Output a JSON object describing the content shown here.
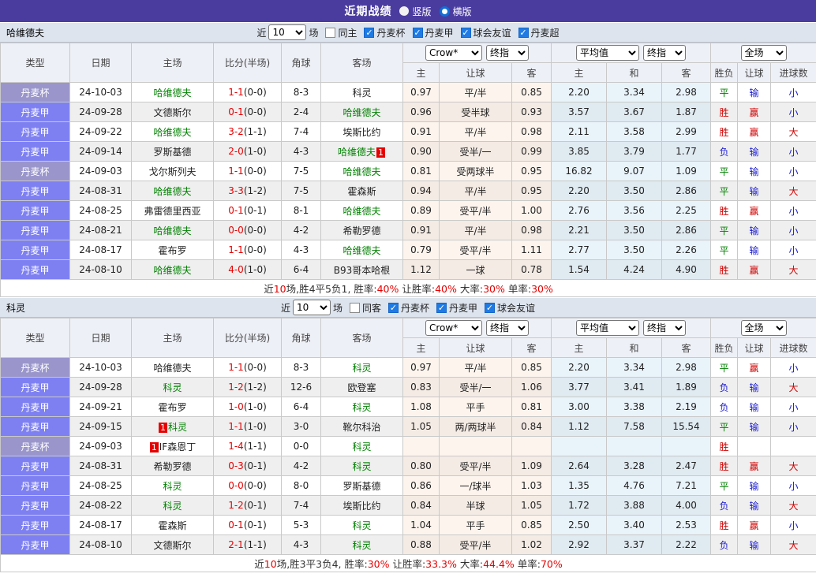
{
  "title_bar": {
    "title": "近期战绩",
    "radios": [
      {
        "label": "竖版",
        "selected": false
      },
      {
        "label": "横版",
        "selected": true
      }
    ]
  },
  "table_columns": {
    "type": "类型",
    "date": "日期",
    "home": "主场",
    "score": "比分(半场)",
    "corner": "角球",
    "away": "客场",
    "odds_home": "主",
    "odds_handicap": "让球",
    "odds_away": "客",
    "avg_home": "主",
    "avg_draw": "和",
    "avg_away": "客",
    "result": "胜负",
    "handicap_result": "让球",
    "goals": "进球数"
  },
  "sections": [
    {
      "team": "哈维德夫",
      "filter": {
        "near_label": "近",
        "count": "10",
        "games_label": "场",
        "same_label": "同主",
        "same_checked": false,
        "leagues": [
          {
            "label": "丹麦杯",
            "checked": true
          },
          {
            "label": "丹麦甲",
            "checked": true
          },
          {
            "label": "球会友谊",
            "checked": true
          },
          {
            "label": "丹麦超",
            "checked": true
          }
        ]
      },
      "selects": {
        "bookmaker": "Crow*",
        "odds_stage": "终指",
        "average": "平均值",
        "avg_stage": "终指",
        "scope": "全场"
      },
      "rows": [
        {
          "league": "丹麦杯",
          "cup": true,
          "date": "24-10-03",
          "home": {
            "name": "哈维德夫",
            "green": true
          },
          "score": "1-1",
          "half": "(0-0)",
          "corner": "8-3",
          "away": {
            "name": "科灵",
            "green": false
          },
          "o1": "0.97",
          "hc": "平/半",
          "o2": "0.85",
          "a1": "2.20",
          "a2": "3.34",
          "a3": "2.98",
          "res": "平",
          "hres": "输",
          "goals": "小"
        },
        {
          "league": "丹麦甲",
          "cup": false,
          "date": "24-09-28",
          "home": {
            "name": "文德斯尔",
            "green": false
          },
          "score": "0-1",
          "half": "(0-0)",
          "corner": "2-4",
          "away": {
            "name": "哈维德夫",
            "green": true
          },
          "o1": "0.96",
          "hc": "受半球",
          "o2": "0.93",
          "a1": "3.57",
          "a2": "3.67",
          "a3": "1.87",
          "res": "胜",
          "hres": "赢",
          "goals": "小"
        },
        {
          "league": "丹麦甲",
          "cup": false,
          "date": "24-09-22",
          "home": {
            "name": "哈维德夫",
            "green": true
          },
          "score": "3-2",
          "half": "(1-1)",
          "corner": "7-4",
          "away": {
            "name": "埃斯比约",
            "green": false
          },
          "o1": "0.91",
          "hc": "平/半",
          "o2": "0.98",
          "a1": "2.11",
          "a2": "3.58",
          "a3": "2.99",
          "res": "胜",
          "hres": "赢",
          "goals": "大"
        },
        {
          "league": "丹麦甲",
          "cup": false,
          "date": "24-09-14",
          "home": {
            "name": "罗斯基德",
            "green": false
          },
          "score": "2-0",
          "half": "(1-0)",
          "corner": "4-3",
          "away": {
            "name": "哈维德夫",
            "green": true,
            "badge_after": "1"
          },
          "o1": "0.90",
          "hc": "受半/一",
          "o2": "0.99",
          "a1": "3.85",
          "a2": "3.79",
          "a3": "1.77",
          "res": "负",
          "hres": "输",
          "goals": "小"
        },
        {
          "league": "丹麦杯",
          "cup": true,
          "date": "24-09-03",
          "home": {
            "name": "戈尔斯列夫",
            "green": false
          },
          "score": "1-1",
          "half": "(0-0)",
          "corner": "7-5",
          "away": {
            "name": "哈维德夫",
            "green": true
          },
          "o1": "0.81",
          "hc": "受两球半",
          "o2": "0.95",
          "a1": "16.82",
          "a2": "9.07",
          "a3": "1.09",
          "res": "平",
          "hres": "输",
          "goals": "小"
        },
        {
          "league": "丹麦甲",
          "cup": false,
          "date": "24-08-31",
          "home": {
            "name": "哈维德夫",
            "green": true
          },
          "score": "3-3",
          "half": "(1-2)",
          "corner": "7-5",
          "away": {
            "name": "霍森斯",
            "green": false
          },
          "o1": "0.94",
          "hc": "平/半",
          "o2": "0.95",
          "a1": "2.20",
          "a2": "3.50",
          "a3": "2.86",
          "res": "平",
          "hres": "输",
          "goals": "大"
        },
        {
          "league": "丹麦甲",
          "cup": false,
          "date": "24-08-25",
          "home": {
            "name": "弗雷德里西亚",
            "green": false
          },
          "score": "0-1",
          "half": "(0-1)",
          "corner": "8-1",
          "away": {
            "name": "哈维德夫",
            "green": true
          },
          "o1": "0.89",
          "hc": "受平/半",
          "o2": "1.00",
          "a1": "2.76",
          "a2": "3.56",
          "a3": "2.25",
          "res": "胜",
          "hres": "赢",
          "goals": "小"
        },
        {
          "league": "丹麦甲",
          "cup": false,
          "date": "24-08-21",
          "home": {
            "name": "哈维德夫",
            "green": true
          },
          "score": "0-0",
          "half": "(0-0)",
          "corner": "4-2",
          "away": {
            "name": "希勒罗德",
            "green": false
          },
          "o1": "0.91",
          "hc": "平/半",
          "o2": "0.98",
          "a1": "2.21",
          "a2": "3.50",
          "a3": "2.86",
          "res": "平",
          "hres": "输",
          "goals": "小"
        },
        {
          "league": "丹麦甲",
          "cup": false,
          "date": "24-08-17",
          "home": {
            "name": "霍布罗",
            "green": false
          },
          "score": "1-1",
          "half": "(0-0)",
          "corner": "4-3",
          "away": {
            "name": "哈维德夫",
            "green": true
          },
          "o1": "0.79",
          "hc": "受平/半",
          "o2": "1.11",
          "a1": "2.77",
          "a2": "3.50",
          "a3": "2.26",
          "res": "平",
          "hres": "输",
          "goals": "小"
        },
        {
          "league": "丹麦甲",
          "cup": false,
          "date": "24-08-10",
          "home": {
            "name": "哈维德夫",
            "green": true
          },
          "score": "4-0",
          "half": "(1-0)",
          "corner": "6-4",
          "away": {
            "name": "B93哥本哈根",
            "green": false
          },
          "o1": "1.12",
          "hc": "一球",
          "o2": "0.78",
          "a1": "1.54",
          "a2": "4.24",
          "a3": "4.90",
          "res": "胜",
          "hres": "赢",
          "goals": "大"
        }
      ],
      "summary": [
        {
          "t": "近",
          "red": false
        },
        {
          "t": "10",
          "red": true
        },
        {
          "t": "场,胜4平5负1, 胜率:",
          "red": false
        },
        {
          "t": "40%",
          "red": true
        },
        {
          "t": " 让胜率:",
          "red": false
        },
        {
          "t": "40%",
          "red": true
        },
        {
          "t": " 大率:",
          "red": false
        },
        {
          "t": "30%",
          "red": true
        },
        {
          "t": " 单率:",
          "red": false
        },
        {
          "t": "30%",
          "red": true
        }
      ]
    },
    {
      "team": "科灵",
      "filter": {
        "near_label": "近",
        "count": "10",
        "games_label": "场",
        "same_label": "同客",
        "same_checked": false,
        "leagues": [
          {
            "label": "丹麦杯",
            "checked": true
          },
          {
            "label": "丹麦甲",
            "checked": true
          },
          {
            "label": "球会友谊",
            "checked": true
          }
        ]
      },
      "selects": {
        "bookmaker": "Crow*",
        "odds_stage": "终指",
        "average": "平均值",
        "avg_stage": "终指",
        "scope": "全场"
      },
      "rows": [
        {
          "league": "丹麦杯",
          "cup": true,
          "date": "24-10-03",
          "home": {
            "name": "哈维德夫",
            "green": false
          },
          "score": "1-1",
          "half": "(0-0)",
          "corner": "8-3",
          "away": {
            "name": "科灵",
            "green": true
          },
          "o1": "0.97",
          "hc": "平/半",
          "o2": "0.85",
          "a1": "2.20",
          "a2": "3.34",
          "a3": "2.98",
          "res": "平",
          "hres": "赢",
          "goals": "小"
        },
        {
          "league": "丹麦甲",
          "cup": false,
          "date": "24-09-28",
          "home": {
            "name": "科灵",
            "green": true
          },
          "score": "1-2",
          "half": "(1-2)",
          "corner": "12-6",
          "away": {
            "name": "欧登塞",
            "green": false
          },
          "o1": "0.83",
          "hc": "受半/一",
          "o2": "1.06",
          "a1": "3.77",
          "a2": "3.41",
          "a3": "1.89",
          "res": "负",
          "hres": "输",
          "goals": "大"
        },
        {
          "league": "丹麦甲",
          "cup": false,
          "date": "24-09-21",
          "home": {
            "name": "霍布罗",
            "green": false
          },
          "score": "1-0",
          "half": "(1-0)",
          "corner": "6-4",
          "away": {
            "name": "科灵",
            "green": true
          },
          "o1": "1.08",
          "hc": "平手",
          "o2": "0.81",
          "a1": "3.00",
          "a2": "3.38",
          "a3": "2.19",
          "res": "负",
          "hres": "输",
          "goals": "小"
        },
        {
          "league": "丹麦甲",
          "cup": false,
          "date": "24-09-15",
          "home": {
            "name": "科灵",
            "green": true,
            "badge_before": "1"
          },
          "score": "1-1",
          "half": "(1-0)",
          "corner": "3-0",
          "away": {
            "name": "靴尔科治",
            "green": false
          },
          "o1": "1.05",
          "hc": "两/两球半",
          "o2": "0.84",
          "a1": "1.12",
          "a2": "7.58",
          "a3": "15.54",
          "res": "平",
          "hres": "输",
          "goals": "小"
        },
        {
          "league": "丹麦杯",
          "cup": true,
          "date": "24-09-03",
          "home": {
            "name": "IF森恩丁",
            "green": false,
            "badge_before": "1"
          },
          "score": "1-4",
          "half": "(1-1)",
          "corner": "0-0",
          "away": {
            "name": "科灵",
            "green": true
          },
          "o1": "",
          "hc": "",
          "o2": "",
          "a1": "",
          "a2": "",
          "a3": "",
          "res": "胜",
          "hres": "",
          "goals": ""
        },
        {
          "league": "丹麦甲",
          "cup": false,
          "date": "24-08-31",
          "home": {
            "name": "希勒罗德",
            "green": false
          },
          "score": "0-3",
          "half": "(0-1)",
          "corner": "4-2",
          "away": {
            "name": "科灵",
            "green": true
          },
          "o1": "0.80",
          "hc": "受平/半",
          "o2": "1.09",
          "a1": "2.64",
          "a2": "3.28",
          "a3": "2.47",
          "res": "胜",
          "hres": "赢",
          "goals": "大"
        },
        {
          "league": "丹麦甲",
          "cup": false,
          "date": "24-08-25",
          "home": {
            "name": "科灵",
            "green": true
          },
          "score": "0-0",
          "half": "(0-0)",
          "corner": "8-0",
          "away": {
            "name": "罗斯基德",
            "green": false
          },
          "o1": "0.86",
          "hc": "一/球半",
          "o2": "1.03",
          "a1": "1.35",
          "a2": "4.76",
          "a3": "7.21",
          "res": "平",
          "hres": "输",
          "goals": "小"
        },
        {
          "league": "丹麦甲",
          "cup": false,
          "date": "24-08-22",
          "home": {
            "name": "科灵",
            "green": true
          },
          "score": "1-2",
          "half": "(0-1)",
          "corner": "7-4",
          "away": {
            "name": "埃斯比约",
            "green": false
          },
          "o1": "0.84",
          "hc": "半球",
          "o2": "1.05",
          "a1": "1.72",
          "a2": "3.88",
          "a3": "4.00",
          "res": "负",
          "hres": "输",
          "goals": "大"
        },
        {
          "league": "丹麦甲",
          "cup": false,
          "date": "24-08-17",
          "home": {
            "name": "霍森斯",
            "green": false
          },
          "score": "0-1",
          "half": "(0-1)",
          "corner": "5-3",
          "away": {
            "name": "科灵",
            "green": true
          },
          "o1": "1.04",
          "hc": "平手",
          "o2": "0.85",
          "a1": "2.50",
          "a2": "3.40",
          "a3": "2.53",
          "res": "胜",
          "hres": "赢",
          "goals": "小"
        },
        {
          "league": "丹麦甲",
          "cup": false,
          "date": "24-08-10",
          "home": {
            "name": "文德斯尔",
            "green": false
          },
          "score": "2-1",
          "half": "(1-1)",
          "corner": "4-3",
          "away": {
            "name": "科灵",
            "green": true
          },
          "o1": "0.88",
          "hc": "受平/半",
          "o2": "1.02",
          "a1": "2.92",
          "a2": "3.37",
          "a3": "2.22",
          "res": "负",
          "hres": "输",
          "goals": "大"
        }
      ],
      "summary": [
        {
          "t": "近",
          "red": false
        },
        {
          "t": "10",
          "red": true
        },
        {
          "t": "场,胜3平3负4, 胜率:",
          "red": false
        },
        {
          "t": "30%",
          "red": true
        },
        {
          "t": " 让胜率:",
          "red": false
        },
        {
          "t": "33.3%",
          "red": true
        },
        {
          "t": " 大率:",
          "red": false
        },
        {
          "t": "44.4%",
          "red": true
        },
        {
          "t": " 单率:",
          "red": false
        },
        {
          "t": "70%",
          "red": true
        }
      ]
    }
  ]
}
